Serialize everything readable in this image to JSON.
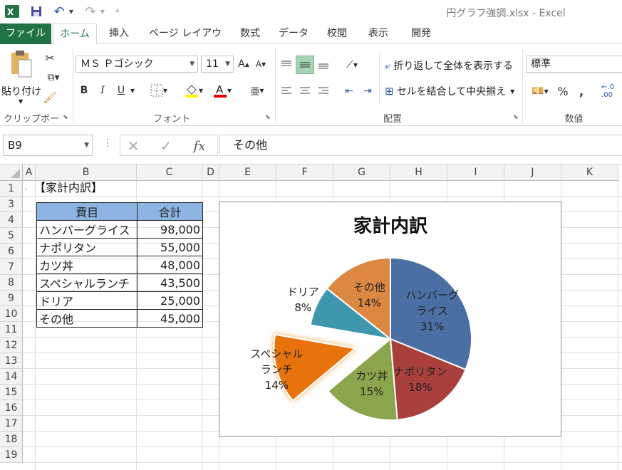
{
  "window": {
    "title": "円グラフ強調.xlsx - Excel"
  },
  "tabs": [
    {
      "label": "ファイル"
    },
    {
      "label": "ホーム"
    },
    {
      "label": "挿入"
    },
    {
      "label": "ページ レイアウト"
    },
    {
      "label": "数式"
    },
    {
      "label": "データ"
    },
    {
      "label": "校閲"
    },
    {
      "label": "表示"
    },
    {
      "label": "開発"
    }
  ],
  "ribbon": {
    "clipboard": {
      "paste_label": "貼り付け",
      "group_label": "クリップボード"
    },
    "font": {
      "name": "ＭＳ Ｐゴシック",
      "size": "11",
      "group_label": "フォント",
      "bold": "B",
      "italic": "I",
      "underline": "U"
    },
    "alignment": {
      "wrap_label": "折り返して全体を表示する",
      "merge_label": "セルを結合して中央揃え",
      "group_label": "配置"
    },
    "number": {
      "format": "標準",
      "group_label": "数値",
      "percent": "%",
      "comma": ","
    }
  },
  "formula_bar": {
    "name_box": "B9",
    "value": "その他"
  },
  "sheet": {
    "columns": [
      "A",
      "B",
      "C",
      "D",
      "E",
      "F",
      "G",
      "H",
      "I",
      "J",
      "K"
    ],
    "rows": [
      "1",
      "3",
      "4",
      "5",
      "6",
      "7",
      "8",
      "9",
      "10",
      "11",
      "12",
      "13",
      "14",
      "15",
      "16",
      "17",
      "18",
      "19"
    ],
    "a1_mark": ".",
    "b1_title": "【家計内訳】",
    "table": {
      "headers": [
        "費目",
        "合計"
      ],
      "rows": [
        {
          "item": "ハンバーグライス",
          "value": "98,000"
        },
        {
          "item": "ナポリタン",
          "value": "55,000"
        },
        {
          "item": "カツ丼",
          "value": "48,000"
        },
        {
          "item": "スペシャルランチ",
          "value": "43,500"
        },
        {
          "item": "ドリア",
          "value": "25,000"
        },
        {
          "item": "その他",
          "value": "45,000"
        }
      ]
    }
  },
  "chart_data": {
    "type": "pie",
    "title": "家計内訳",
    "categories": [
      "ハンバーグライス",
      "ナポリタン",
      "カツ丼",
      "スペシャルランチ",
      "ドリア",
      "その他"
    ],
    "values": [
      98000,
      55000,
      48000,
      43500,
      25000,
      45000
    ],
    "label_lines": [
      [
        "ハンバーグ",
        "ライス",
        "31%"
      ],
      [
        "ナポリタン",
        "18%"
      ],
      [
        "カツ丼",
        "15%"
      ],
      [
        "スペシャル",
        "ランチ",
        "14%"
      ],
      [
        "ドリア",
        "8%"
      ],
      [
        "その他",
        "14%"
      ]
    ],
    "colors": [
      "#4a6fa5",
      "#a9403e",
      "#8aa54c",
      "#e8730e",
      "#3f97ae",
      "#dc8843"
    ],
    "exploded": "スペシャルランチ",
    "legend": "none"
  }
}
